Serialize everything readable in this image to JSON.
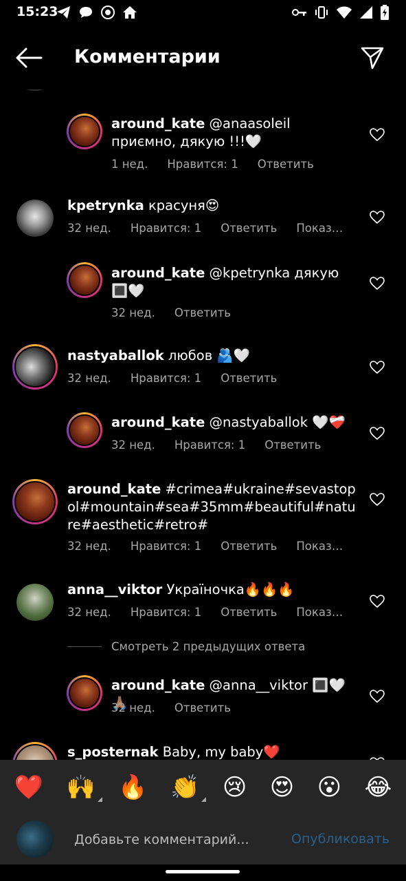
{
  "status_bar": {
    "time": "15:23",
    "left_icons": [
      "telegram-icon",
      "chat-bubble-icon",
      "camera-timer-icon",
      "home-icon"
    ],
    "right_icons": [
      "key-icon",
      "vibrate-icon",
      "wifi-icon",
      "signal-icon",
      "battery-charging-icon"
    ]
  },
  "header": {
    "title": "Комментарии",
    "back_icon": "arrow-left-icon",
    "send_icon": "paper-plane-icon"
  },
  "comments": [
    {
      "user": "around_kate",
      "text": " @anaasoleil приємно, дякую !!!🤍",
      "time": "1 нед.",
      "likes": "Нравится: 1",
      "reply": "Ответить",
      "show": ""
    },
    {
      "user": "kpetrynka",
      "text": " красуня😍",
      "time": "32 нед.",
      "likes": "Нравится: 1",
      "reply": "Ответить",
      "show": "Показ…"
    },
    {
      "user": "around_kate",
      "text": " @kpetrynka дякую 🔳🤍",
      "time": "32 нед.",
      "likes": "",
      "reply": "Ответить",
      "show": ""
    },
    {
      "user": "nastyaballok",
      "text": " любов 🫂🤍",
      "time": "32 нед.",
      "likes": "Нравится: 1",
      "reply": "Ответить",
      "show": ""
    },
    {
      "user": "around_kate",
      "text": " @nastyaballok 🤍❤️‍🩹",
      "time": "32 нед.",
      "likes": "Нравится: 1",
      "reply": "Ответить",
      "show": ""
    },
    {
      "user": "around_kate",
      "text": " #crimea#ukraine#sevastopol#mountain#sea#35mm#beautiful#nature#aesthetic#retro#",
      "time": "32 нед.",
      "likes": "Нравится: 1",
      "reply": "Ответить",
      "show": "Показ…"
    },
    {
      "user": "anna__viktor",
      "text": " Україночка🔥🔥🔥",
      "time": "32 нед.",
      "likes": "Нравится: 1",
      "reply": "Ответить",
      "show": "Показ…"
    },
    {
      "user": "around_kate",
      "text": " @anna__viktor 🔳🤍🙏🏽",
      "time": "32 нед.",
      "likes": "",
      "reply": "Ответить",
      "show": ""
    },
    {
      "user": "s_posternak",
      "text": " Baby, my baby❤️",
      "time": "",
      "likes": "",
      "reply": "",
      "show": ""
    }
  ],
  "view_replies": "Смотреть 2 предыдущих ответа",
  "emoji_bar": [
    "❤️",
    "🙌",
    "🔥",
    "👏",
    "😢",
    "😍",
    "😮",
    "😂"
  ],
  "input": {
    "placeholder": "Добавьте комментарий...",
    "post_label": "Опубликовать"
  },
  "colors": {
    "background": "#000000",
    "meta_text": "#a8a8a8",
    "bar_background": "#262626",
    "post_link": "#2b5f8a"
  }
}
